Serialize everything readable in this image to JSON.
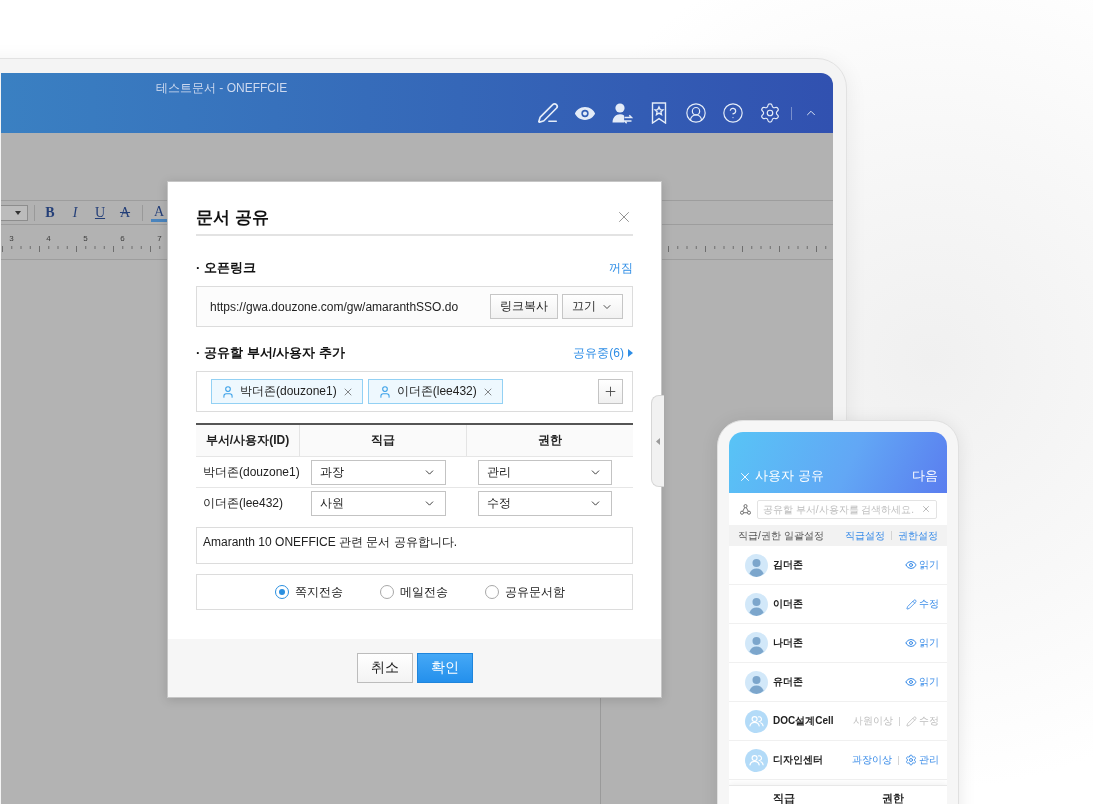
{
  "window": {
    "title": "테스트문서 - ONEFFCIE"
  },
  "editor": {
    "format_buttons": [
      {
        "label": "B",
        "kind": "bold"
      },
      {
        "label": "I",
        "kind": "italic"
      },
      {
        "label": "U",
        "kind": "underline"
      },
      {
        "label": "A",
        "kind": "strike"
      },
      {
        "label": "A",
        "kind": "color"
      }
    ],
    "ruler": [
      "3",
      "4",
      "5",
      "6",
      "7"
    ]
  },
  "dialog": {
    "title": "문서 공유",
    "open_link": {
      "label": "· 오픈링크",
      "status": "꺼짐",
      "url": "https://gwa.douzone.com/gw/amaranthSSO.do",
      "copy_button": "링크복사",
      "mode": "끄기"
    },
    "share": {
      "label": "· 공유할 부서/사용자 추가",
      "shared_link": "공유중(6)",
      "chips": [
        {
          "label": "박더존(douzone1)"
        },
        {
          "label": "이더존(lee432)"
        }
      ]
    },
    "table": {
      "columns": [
        "부서/사용자(ID)",
        "직급",
        "권한"
      ],
      "rows": [
        {
          "user": "박더존(douzone1)",
          "rank": "과장",
          "permission": "관리"
        },
        {
          "user": "이더존(lee432)",
          "rank": "사원",
          "permission": "수정"
        }
      ]
    },
    "message": {
      "value": "Amaranth 10 ONEFFICE 관련 문서 공유합니다."
    },
    "send_options": [
      {
        "label": "쪽지전송",
        "selected": true
      },
      {
        "label": "메일전송",
        "selected": false
      },
      {
        "label": "공유문서함",
        "selected": false
      }
    ],
    "buttons": [
      {
        "label": "취소",
        "kind": "secondary"
      },
      {
        "label": "확인",
        "kind": "primary"
      }
    ]
  },
  "mobile": {
    "title": "사용자 공유",
    "next": "다음",
    "search": {
      "placeholder": "공유할 부서/사용자를 검색하세요."
    },
    "bulk": {
      "label": "직급/권한 일괄설정",
      "actions": [
        "직급설정",
        "권한설정"
      ]
    },
    "members": [
      {
        "name": "김더존",
        "kind": "person",
        "permission": {
          "kind": "read",
          "label": "읽기"
        },
        "disabled": false
      },
      {
        "name": "이더존",
        "kind": "person",
        "permission": {
          "kind": "edit",
          "label": "수정"
        },
        "disabled": false
      },
      {
        "name": "나더존",
        "kind": "person",
        "permission": {
          "kind": "read",
          "label": "읽기"
        },
        "disabled": false
      },
      {
        "name": "유더존",
        "kind": "person",
        "permission": {
          "kind": "read",
          "label": "읽기"
        },
        "disabled": false
      },
      {
        "name": "DOC설계Cell",
        "kind": "group",
        "rank": "사원이상",
        "permission": {
          "kind": "edit",
          "label": "수정"
        },
        "disabled": true
      },
      {
        "name": "디자인센터",
        "kind": "group",
        "rank": "과장이상",
        "permission": {
          "kind": "manage",
          "label": "관리"
        },
        "disabled": false
      }
    ],
    "tabs": [
      {
        "label": "직급"
      },
      {
        "label": "권한"
      }
    ]
  }
}
